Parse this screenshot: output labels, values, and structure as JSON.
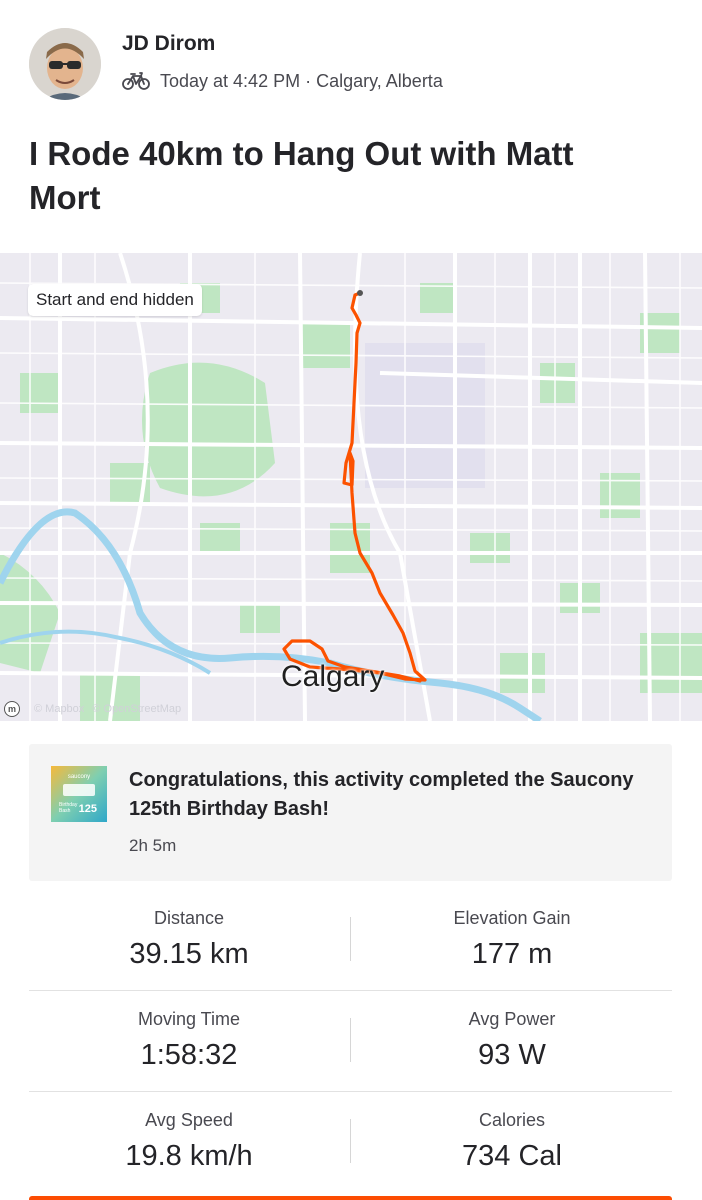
{
  "activity": {
    "athlete_name": "JD Dirom",
    "timestamp": "Today at 4:42 PM",
    "location": "Calgary, Alberta",
    "sport_icon": "bike-icon",
    "title": "I Rode 40km to Hang Out with Matt Mort"
  },
  "map": {
    "privacy_badge": "Start and end hidden",
    "city_label": "Calgary",
    "attribution": [
      "© Mapbox",
      "© OpenStreetMap"
    ],
    "route_color": "#fc5200"
  },
  "challenge": {
    "badge_brand": "saucony",
    "badge_line1": "Birthday",
    "badge_line2": "Bash",
    "badge_number": "125",
    "message": "Congratulations, this activity completed the Saucony 125th Birthday Bash!",
    "duration": "2h 5m"
  },
  "stats": [
    {
      "left_label": "Distance",
      "left_value": "39.15 km",
      "right_label": "Elevation Gain",
      "right_value": "177 m"
    },
    {
      "left_label": "Moving Time",
      "left_value": "1:58:32",
      "right_label": "Avg Power",
      "right_value": "93 W"
    },
    {
      "left_label": "Avg Speed",
      "left_value": "19.8 km/h",
      "right_label": "Calories",
      "right_value": "734 Cal"
    }
  ],
  "colors": {
    "accent": "#fc4c02",
    "text_primary": "#242428",
    "text_secondary": "#494950"
  }
}
